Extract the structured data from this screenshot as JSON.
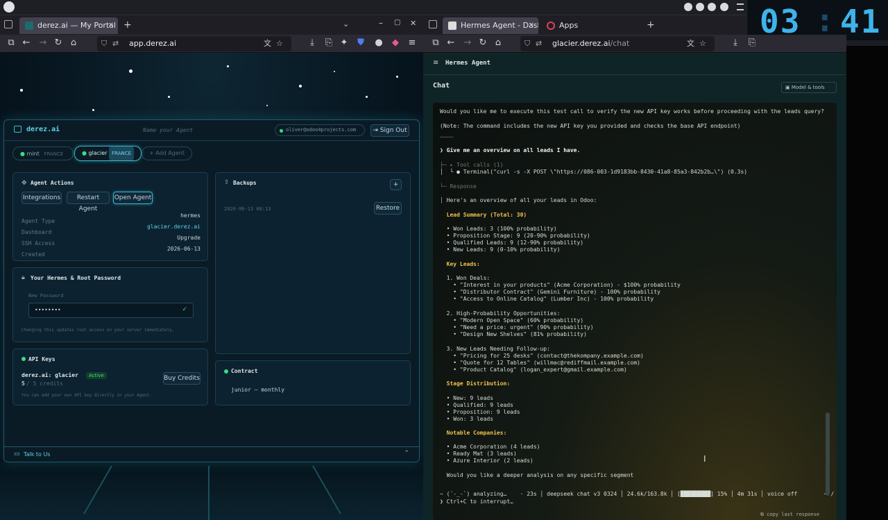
{
  "clock": {
    "hours": "03",
    "minutes": "41"
  },
  "left_browser": {
    "tab_title": "derez.ai — My Portal",
    "url": "app.derez.ai"
  },
  "right_browser": {
    "tab1_title": "Hermes Agent - Dashbo",
    "tab2_title": "Apps",
    "url_host": "glacier.derez.ai",
    "url_path": "/chat"
  },
  "portal": {
    "brand": "derez.ai",
    "agent_name_placeholder": "Name your Agent",
    "user_email": "oliver@odoo4projects.com",
    "sign_out": "Sign Out",
    "agents": [
      {
        "name": "mint",
        "region": "FRANCE"
      },
      {
        "name": "glacier",
        "region": "FRANCE"
      }
    ],
    "add_agent": "+ Add Agent",
    "agent_actions": {
      "title": "Agent Actions",
      "buttons": [
        "Integrations",
        "Restart Agent",
        "Open Agent"
      ],
      "rows": [
        {
          "label": "Agent Type",
          "value": "hermes"
        },
        {
          "label": "Dashboard",
          "value": "glacier.derez.ai"
        },
        {
          "label": "SSH Access",
          "value": "Upgrade"
        },
        {
          "label": "Created",
          "value": "2026-06-13"
        }
      ]
    },
    "backups": {
      "title": "Backups",
      "entry": "2026-06-13 08:13",
      "restore": "Restore"
    },
    "password": {
      "title": "Your Hermes & Root Password",
      "field_label": "New Password",
      "value": "••••••••",
      "hint": "Changing this updates root access on your server immediately."
    },
    "api_keys": {
      "title": "API Keys",
      "key_name": "derez.ai: glacier",
      "status": "Active",
      "credits_num": "5",
      "credits_rest": " / 5 credits",
      "buy": "Buy Credits",
      "hint": "You can add your own API key directly in your Agent."
    },
    "contract": {
      "title": "Contract",
      "plan": "junior – monthly"
    },
    "talk": "Talk to Us"
  },
  "hermes": {
    "app_title": "Hermes Agent",
    "section": "Chat",
    "model_tools": "Model & tools",
    "terminal_lines": [
      {
        "t": "Would you like me to execute this test call to verify the new API key works before proceeding with the leads query?",
        "c": ""
      },
      {
        "t": "(Note: The command includes the new API key you provided and checks the base API endpoint)",
        "c": ""
      },
      {
        "t": "────",
        "c": "g"
      },
      {
        "t": "❯ Give me an overview on all leads I have.",
        "c": "w"
      },
      {
        "t": "├─ ▸ Tool calls (1)",
        "c": "g"
      },
      {
        "t": "│  └ ● Terminal(\"curl -s -X POST \\\"https://086-003-1d9183bb-8430-41a8-85a3-842b2b…\\\") (0.3s)",
        "c": ""
      },
      {
        "t": "└─ Response",
        "c": "g"
      },
      {
        "t": "┆ Here's an overview of all your leads in Odoo:",
        "c": ""
      },
      {
        "t": "  Lead Summary (Total: 30)",
        "c": "y"
      },
      {
        "t": "  • Won Leads: 3 (100% probability)",
        "c": ""
      },
      {
        "t": "  • Proposition Stage: 9 (20-90% probability)",
        "c": ""
      },
      {
        "t": "  • Qualified Leads: 9 (12-90% probability)",
        "c": ""
      },
      {
        "t": "  • New Leads: 9 (0-10% probability)",
        "c": ""
      },
      {
        "t": "  Key Leads:",
        "c": "y"
      },
      {
        "t": "  1. Won Deals:",
        "c": ""
      },
      {
        "t": "    • \"Interest in your products\" (Acme Corporation) - $100% probability",
        "c": ""
      },
      {
        "t": "    • \"Distributor Contract\" (Gemini Furniture) - 100% probability",
        "c": ""
      },
      {
        "t": "    • \"Access to Online Catalog\" (Lumber Inc) - 100% probability",
        "c": ""
      },
      {
        "t": "  2. High-Probability Opportunities:",
        "c": ""
      },
      {
        "t": "    • \"Modern Open Space\" (60% probability)",
        "c": ""
      },
      {
        "t": "    • \"Need a price: urgent\" (90% probability)",
        "c": ""
      },
      {
        "t": "    • \"Design New Shelves\" (81% probability)",
        "c": ""
      },
      {
        "t": "  3. New Leads Needing Follow-up:",
        "c": ""
      },
      {
        "t": "    • \"Pricing for 25 desks\" (contact@thekompany.example.com)",
        "c": ""
      },
      {
        "t": "    • \"Quote for 12 Tables\" (willmac@rediffmail.example.com)",
        "c": ""
      },
      {
        "t": "    • \"Product Catalog\" (logan_expert@gmail.example.com)",
        "c": ""
      },
      {
        "t": "  Stage Distribution:",
        "c": "y"
      },
      {
        "t": "  • New: 9 leads",
        "c": ""
      },
      {
        "t": "  • Qualified: 9 leads",
        "c": ""
      },
      {
        "t": "  • Proposition: 9 leads",
        "c": ""
      },
      {
        "t": "  • Won: 3 leads",
        "c": ""
      },
      {
        "t": "  Notable Companies:",
        "c": "y"
      },
      {
        "t": "  • Acme Corporation (4 leads)",
        "c": ""
      },
      {
        "t": "  • Ready Mat (3 leads)",
        "c": ""
      },
      {
        "t": "  • Azure Interior (2 leads)",
        "c": ""
      },
      {
        "t": "  Would you like a deeper analysis on any specific segment",
        "c": ""
      },
      {
        "t": "~ (´-_-`) analyzing…    · 23s │ deepseek chat v3 0324 │ 24.6k/163.8k │ [█████████] 15% │ 4m 31s │ voice off        ─ /",
        "c": ""
      },
      {
        "t": "❯ Ctrl+C to interrupt…",
        "c": ""
      }
    ],
    "copy_last": "copy last response"
  }
}
